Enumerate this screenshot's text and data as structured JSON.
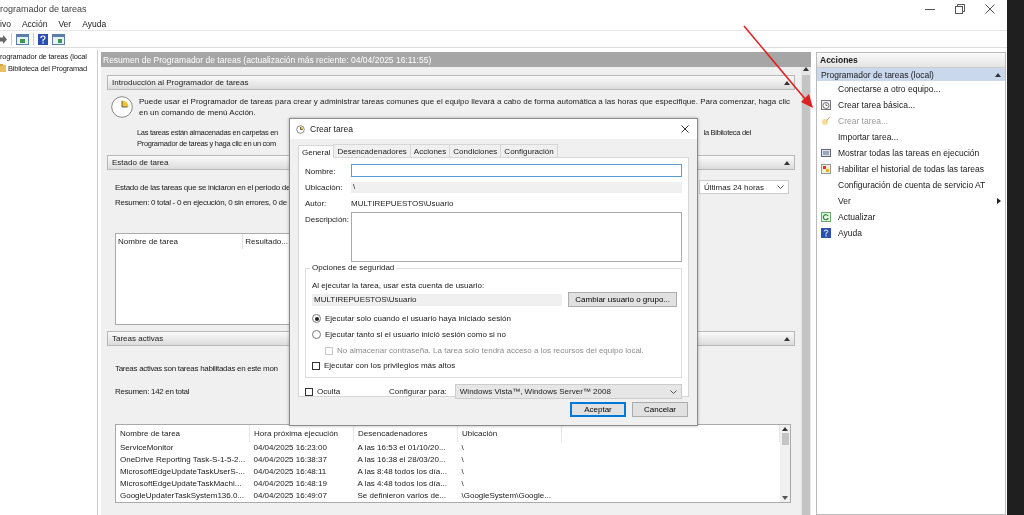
{
  "window": {
    "title": "rogramador de tareas"
  },
  "menu": [
    "ivo",
    "Acción",
    "Ver",
    "Ayuda"
  ],
  "tree": [
    {
      "label": "rogramador de tareas (local",
      "children": [
        {
          "label": "Biblioteca del Programad"
        }
      ]
    }
  ],
  "summary": {
    "header": "Resumen de Programador de tareas (actualización más reciente: 04/04/2025 16:11:55)",
    "intro": {
      "title": "Introducción al Programador de tareas",
      "text": "Puede usar el Programador de tareas para crear y administrar tareas comunes que el equipo llevará a cabo de forma automática a las horas que especifique. Para comenzar, haga clic en un comando de menú Acción.",
      "fragments": [
        "Las tareas están almacenadas en carpetas en",
        "la Biblioteca del",
        "Programador de tareas y haga clic en un com"
      ]
    },
    "status": {
      "title": "Estado de tarea",
      "text": "Estado de las tareas que se iniciaron en el período de",
      "period": "Últimas 24 horas",
      "summary": "Resumen: 0 total - 0 en ejecución, 0 sin errores, 0 de",
      "columns": [
        "Nombre de tarea",
        "Resultado..."
      ]
    },
    "active": {
      "title": "Tareas activas",
      "text": "Tareas activas son tareas habilitadas en este mon",
      "summary": "Resumen: 142 en total",
      "columns": [
        "Nombre de tarea",
        "Hora próxima ejecución",
        "Desencadenadores",
        "Ubicación"
      ],
      "rows": [
        [
          "ServiceMonitor",
          "04/04/2025 16:23:00",
          "A las 16:53 el 01/10/20...",
          "\\"
        ],
        [
          "OneDrive Reporting Task-S-1-5-2...",
          "04/04/2025 16:38:37",
          "A las 16:38 el 28/03/20...",
          "\\"
        ],
        [
          "MicrosoftEdgeUpdateTaskUserS-...",
          "04/04/2025 16:48:11",
          "A las 8:48 todos los día...",
          "\\"
        ],
        [
          "MicrosoftEdgeUpdateTaskMachi...",
          "04/04/2025 16:48:19",
          "A las 4:48 todos los día...",
          "\\"
        ],
        [
          "GoogleUpdaterTaskSystem136.0...",
          "04/04/2025 16:49:07",
          "Se definieron varios de...",
          "\\GoogleSystem\\Google..."
        ]
      ]
    }
  },
  "actions": {
    "title": "Acciones",
    "group": "Programador de tareas (local)",
    "items": [
      {
        "label": "Conectarse a otro equipo...",
        "disabled": false,
        "submenu": false
      },
      {
        "label": "Crear tarea básica...",
        "disabled": false,
        "submenu": false
      },
      {
        "label": "Crear tarea...",
        "disabled": true,
        "submenu": false
      },
      {
        "label": "Importar tarea...",
        "disabled": false,
        "submenu": false
      },
      {
        "label": "Mostrar todas las tareas en ejecución",
        "disabled": false,
        "submenu": false
      },
      {
        "label": "Habilitar el historial de todas las tareas",
        "disabled": false,
        "submenu": false
      },
      {
        "label": "Configuración de cuenta de servicio AT",
        "disabled": false,
        "submenu": false
      },
      {
        "label": "Ver",
        "disabled": false,
        "submenu": true
      },
      {
        "label": "Actualizar",
        "disabled": false,
        "submenu": false
      },
      {
        "label": "Ayuda",
        "disabled": false,
        "submenu": false
      }
    ]
  },
  "dialog": {
    "title": "Crear tarea",
    "tabs": [
      {
        "label": "General",
        "selected": true
      },
      {
        "label": "Desencadenadores",
        "selected": false
      },
      {
        "label": "Acciones",
        "selected": false
      },
      {
        "label": "Condiciones",
        "selected": false
      },
      {
        "label": "Configuración",
        "selected": false
      }
    ],
    "name_label": "Nombre:",
    "location_label": "Ubicación:",
    "location": "\\",
    "author_label": "Autor:",
    "author": "MULTIREPUESTOS\\Usuario",
    "description_label": "Descripción:",
    "security": {
      "title": "Opciones de seguridad",
      "account_label": "Al ejecutar la tarea, usar esta cuenta de usuario:",
      "account": "MULTIREPUESTOS\\Usuario",
      "change_button": "Cambiar usuario o grupo...",
      "radios": [
        {
          "label": "Ejecutar solo cuando el usuario haya iniciado sesión",
          "selected": true
        },
        {
          "label": "Ejecutar tanto si el usuario inició sesión como si no",
          "selected": false
        }
      ],
      "store_password": {
        "label": "No almacenar contraseña. La tarea solo tendrá acceso a los recursos del equipo local.",
        "checked": false,
        "disabled": true
      },
      "highest": {
        "label": "Ejecutar con los privilegios más altos",
        "checked": false,
        "disabled": false
      }
    },
    "hidden": {
      "label": "Oculta",
      "checked": false
    },
    "configure_label": "Configurar para:",
    "configure_value": "Windows Vista™, Windows Server™ 2008",
    "buttons": [
      {
        "label": "Aceptar",
        "default": true
      },
      {
        "label": "Cancelar",
        "default": false
      }
    ]
  }
}
